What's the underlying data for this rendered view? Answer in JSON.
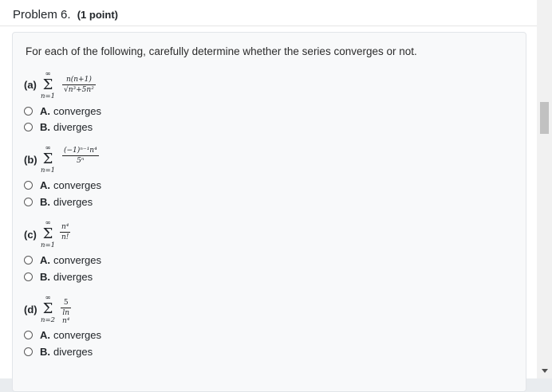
{
  "problem": {
    "title": "Problem 6.",
    "points": "(1 point)"
  },
  "intro": "For each of the following, carefully determine whether the series converges or not.",
  "parts": [
    {
      "label": "(a)",
      "upper": "∞",
      "lower": "n=1",
      "numerator": "n(n+1)",
      "denominator": "√n³+5n²",
      "options": [
        {
          "letter": "A.",
          "text": "converges"
        },
        {
          "letter": "B.",
          "text": "diverges"
        }
      ]
    },
    {
      "label": "(b)",
      "upper": "∞",
      "lower": "n=1",
      "numerator": "(−1)ⁿ⁻¹n⁴",
      "denominator": "5ⁿ",
      "options": [
        {
          "letter": "A.",
          "text": "converges"
        },
        {
          "letter": "B.",
          "text": "diverges"
        }
      ]
    },
    {
      "label": "(c)",
      "upper": "∞",
      "lower": "n=1",
      "numerator": "n⁴",
      "denominator": "n!",
      "options": [
        {
          "letter": "A.",
          "text": "converges"
        },
        {
          "letter": "B.",
          "text": "diverges"
        }
      ]
    },
    {
      "label": "(d)",
      "upper": "∞",
      "lower": "n=2",
      "numerator": "5",
      "denominator": "ln n⁴",
      "options": [
        {
          "letter": "A.",
          "text": "converges"
        },
        {
          "letter": "B.",
          "text": "diverges"
        }
      ]
    }
  ],
  "icons": {
    "radio": "radio-button-icon",
    "scroll_down": "chevron-down-icon"
  },
  "colors": {
    "card_background": "#f8f9fa",
    "text": "#212529"
  }
}
